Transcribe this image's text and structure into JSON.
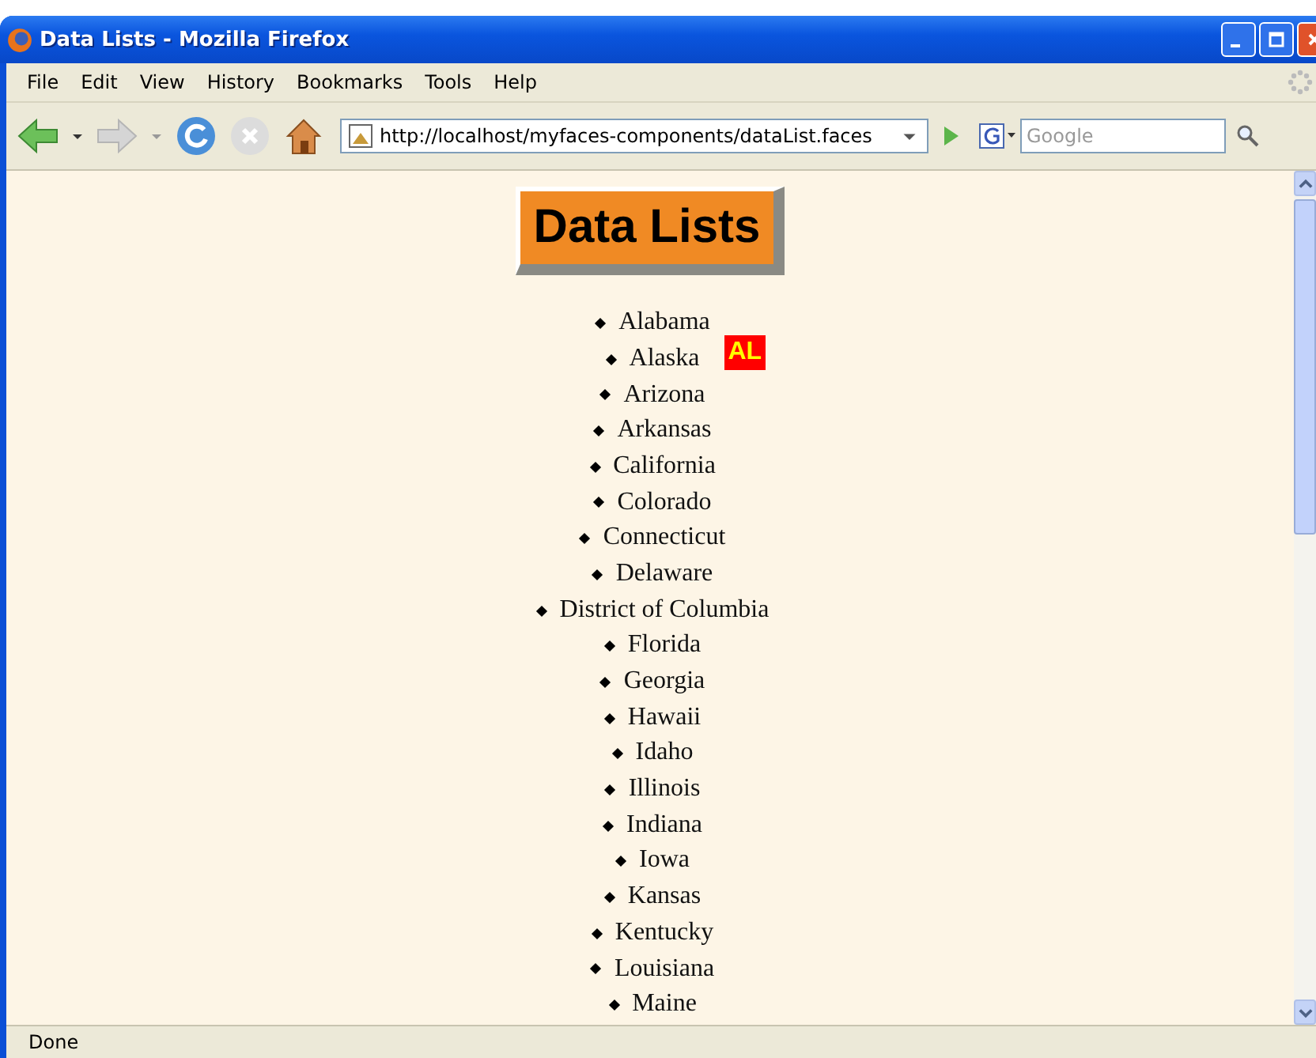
{
  "window": {
    "title": "Data Lists - Mozilla Firefox"
  },
  "menu": [
    "File",
    "Edit",
    "View",
    "History",
    "Bookmarks",
    "Tools",
    "Help"
  ],
  "address_bar": {
    "value": "http://localhost/myfaces-components/dataList.faces"
  },
  "search": {
    "placeholder": "Google"
  },
  "heading": "Data Lists",
  "items": [
    {
      "label": "Alabama"
    },
    {
      "label": "Alaska",
      "tooltip": "AL"
    },
    {
      "label": "Arizona"
    },
    {
      "label": "Arkansas"
    },
    {
      "label": "California"
    },
    {
      "label": "Colorado"
    },
    {
      "label": "Connecticut"
    },
    {
      "label": "Delaware"
    },
    {
      "label": "District of Columbia"
    },
    {
      "label": "Florida"
    },
    {
      "label": "Georgia"
    },
    {
      "label": "Hawaii"
    },
    {
      "label": "Idaho"
    },
    {
      "label": "Illinois"
    },
    {
      "label": "Indiana"
    },
    {
      "label": "Iowa"
    },
    {
      "label": "Kansas"
    },
    {
      "label": "Kentucky"
    },
    {
      "label": "Louisiana"
    },
    {
      "label": "Maine"
    }
  ],
  "status_bar": "Done"
}
